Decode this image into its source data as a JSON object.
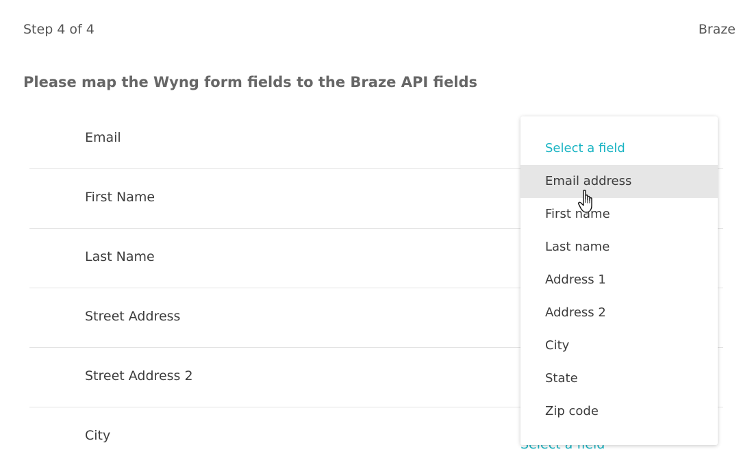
{
  "header": {
    "step": "Step 4 of 4",
    "brand": "Braze",
    "instruction": "Please map the Wyng form fields to the Braze API fields"
  },
  "rows": [
    {
      "label": "Email",
      "select": ""
    },
    {
      "label": "First Name",
      "select": ""
    },
    {
      "label": "Last Name",
      "select": ""
    },
    {
      "label": "Street Address",
      "select": ""
    },
    {
      "label": "Street Address 2",
      "select": ""
    },
    {
      "label": "City",
      "select": "Select a field"
    }
  ],
  "dropdown": {
    "placeholder": "Select a field",
    "options": [
      "Email address",
      "First name",
      "Last name",
      "Address 1",
      "Address 2",
      "City",
      "State",
      "Zip code"
    ],
    "hovered_index": 0
  },
  "colors": {
    "accent": "#1ab4c3",
    "hover_bg": "#e6e6e6"
  },
  "icons": {
    "cursor": "hand-pointer-icon"
  }
}
